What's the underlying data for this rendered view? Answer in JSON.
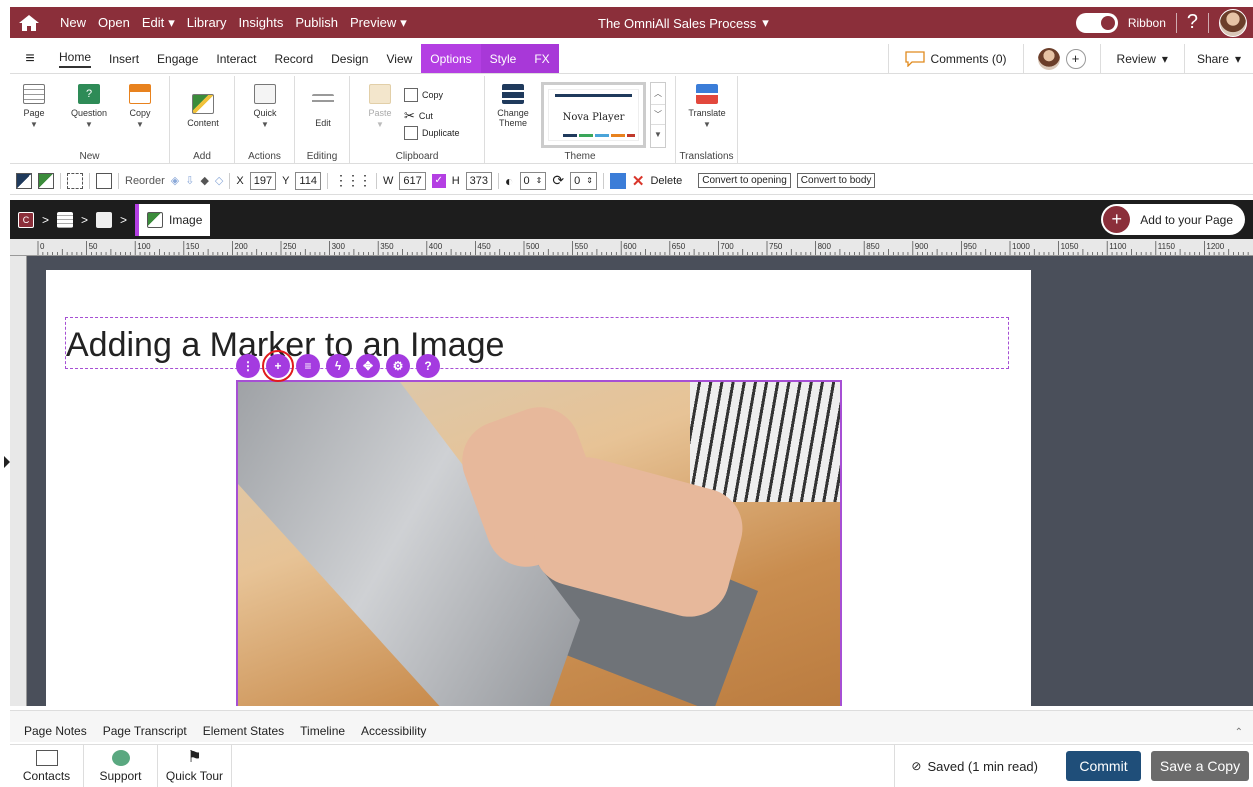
{
  "topbar": {
    "menu": [
      "New",
      "Open",
      "Edit",
      "Library",
      "Insights",
      "Publish",
      "Preview"
    ],
    "title": "The OmniAll Sales Process",
    "ribbon_label": "Ribbon",
    "help": "?"
  },
  "tabs": {
    "items": [
      "Home",
      "Insert",
      "Engage",
      "Interact",
      "Record",
      "Design",
      "View",
      "Options",
      "Style",
      "FX"
    ],
    "comments": "Comments (0)",
    "review": "Review",
    "share": "Share",
    "plus": "+"
  },
  "ribbon": {
    "new_group": "New",
    "page": "Page",
    "question": "Question",
    "copy_btn": "Copy",
    "add_group": "Add",
    "content": "Content",
    "actions_group": "Actions",
    "quick": "Quick",
    "editing_group": "Editing",
    "edit": "Edit",
    "clipboard_group": "Clipboard",
    "paste": "Paste",
    "copy": "Copy",
    "cut": "Cut",
    "duplicate": "Duplicate",
    "theme_group": "Theme",
    "change_theme_1": "Change",
    "change_theme_2": "Theme",
    "theme_name": "Nova Player",
    "translations_group": "Translations",
    "translate": "Translate"
  },
  "props": {
    "reorder": "Reorder",
    "x_label": "X",
    "x_value": "197",
    "y_label": "Y",
    "y_value": "114",
    "w_label": "W",
    "w_value": "617",
    "h_label": "H",
    "h_value": "373",
    "opacity": "0",
    "rotation": "0",
    "delete": "Delete",
    "convert_opening": "Convert to opening",
    "convert_body": "Convert to body"
  },
  "crumbs": {
    "sep": ">",
    "c_label": "C",
    "current": "Image",
    "add_to_page": "Add to your Page"
  },
  "ruler_marks": [
    "0",
    "50",
    "100",
    "150",
    "200",
    "250",
    "300",
    "350",
    "400",
    "450",
    "500",
    "550",
    "600",
    "650",
    "700",
    "750",
    "800",
    "850",
    "900",
    "950",
    "1000",
    "1050",
    "1100",
    "1150",
    "1200"
  ],
  "canvas": {
    "page_title": "Adding a Marker to an Image"
  },
  "bottom_tabs": [
    "Page Notes",
    "Page Transcript",
    "Element States",
    "Timeline",
    "Accessibility"
  ],
  "footer": {
    "contacts": "Contacts",
    "support": "Support",
    "quick_tour": "Quick Tour",
    "saved": "Saved (1 min read)",
    "commit": "Commit",
    "save_copy": "Save a Copy"
  },
  "colors": {
    "brand": "#8b2f3a",
    "accent_purple": "#b43fe3",
    "commit": "#1f4e79"
  }
}
